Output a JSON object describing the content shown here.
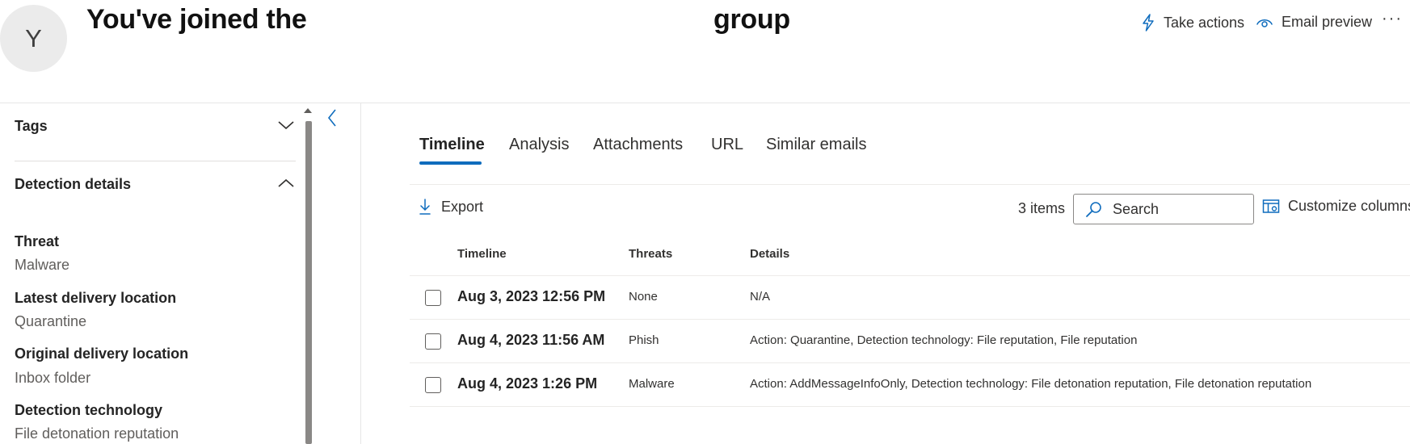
{
  "header": {
    "avatar_initial": "Y",
    "title_left": "You've joined the",
    "title_right": "group",
    "actions": [
      {
        "label": "Take actions",
        "icon": "lightning-icon"
      },
      {
        "label": "Email preview",
        "icon": "eye-icon"
      }
    ],
    "more_label": "···"
  },
  "sidebar": {
    "tags_label": "Tags",
    "detection_label": "Detection details",
    "fields": [
      {
        "label": "Threat",
        "value": "Malware"
      },
      {
        "label": "Latest delivery location",
        "value": "Quarantine"
      },
      {
        "label": "Original delivery location",
        "value": "Inbox folder"
      },
      {
        "label": "Detection technology",
        "value": "File detonation reputation"
      }
    ]
  },
  "tabs": [
    {
      "label": "Timeline",
      "active": true
    },
    {
      "label": "Analysis",
      "active": false
    },
    {
      "label": "Attachments",
      "active": false
    },
    {
      "label": "URL",
      "active": false
    },
    {
      "label": "Similar emails",
      "active": false
    }
  ],
  "toolbar": {
    "export_label": "Export",
    "item_count": "3 items",
    "search_placeholder": "Search",
    "customize_label": "Customize columns"
  },
  "table": {
    "columns": [
      "Timeline",
      "Threats",
      "Details"
    ],
    "rows": [
      {
        "time": "Aug 3, 2023 12:56 PM",
        "threat": "None",
        "details": "N/A"
      },
      {
        "time": "Aug 4, 2023 11:56 AM",
        "threat": "Phish",
        "details": "Action: Quarantine, Detection technology: File reputation, File reputation"
      },
      {
        "time": "Aug 4, 2023 1:26 PM",
        "threat": "Malware",
        "details": "Action: AddMessageInfoOnly, Detection technology: File detonation reputation, File detonation reputation"
      }
    ]
  },
  "colors": {
    "accent": "#0f6cbd",
    "text": "#242424",
    "muted": "#605e5c"
  }
}
